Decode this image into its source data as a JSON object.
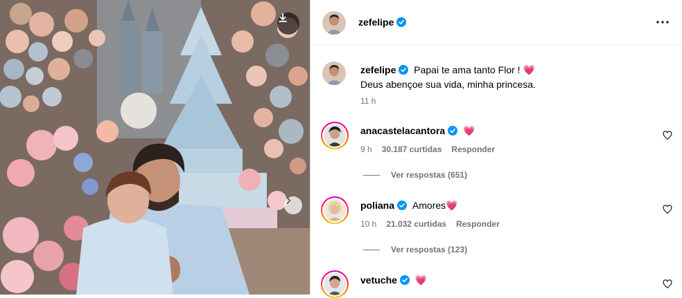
{
  "post": {
    "author": "zefelipe",
    "caption_line1": "Papai te ama tanto Flor ! 💗",
    "caption_line2": "Deus abençoe sua vida, minha princesa.",
    "caption_time": "11 h"
  },
  "comments": [
    {
      "username": "anacastelacantora",
      "text": "💗",
      "time": "9 h",
      "likes": "30.187 curtidas",
      "reply": "Responder",
      "view_replies": "Ver respostas (651)"
    },
    {
      "username": "poliana",
      "text": "Amores💗",
      "time": "10 h",
      "likes": "21.032 curtidas",
      "reply": "Responder",
      "view_replies": "Ver respostas (123)"
    },
    {
      "username": "vetuche",
      "text": "💗"
    }
  ],
  "icons": {
    "download": "download-icon",
    "next": "chevron-right-icon",
    "more": "more-options-icon",
    "verified": "verified-badge-icon",
    "like": "heart-outline-icon"
  },
  "colors": {
    "verified_blue": "#0095f6",
    "meta_gray": "#737373",
    "heart_pink": "#e8336d"
  }
}
